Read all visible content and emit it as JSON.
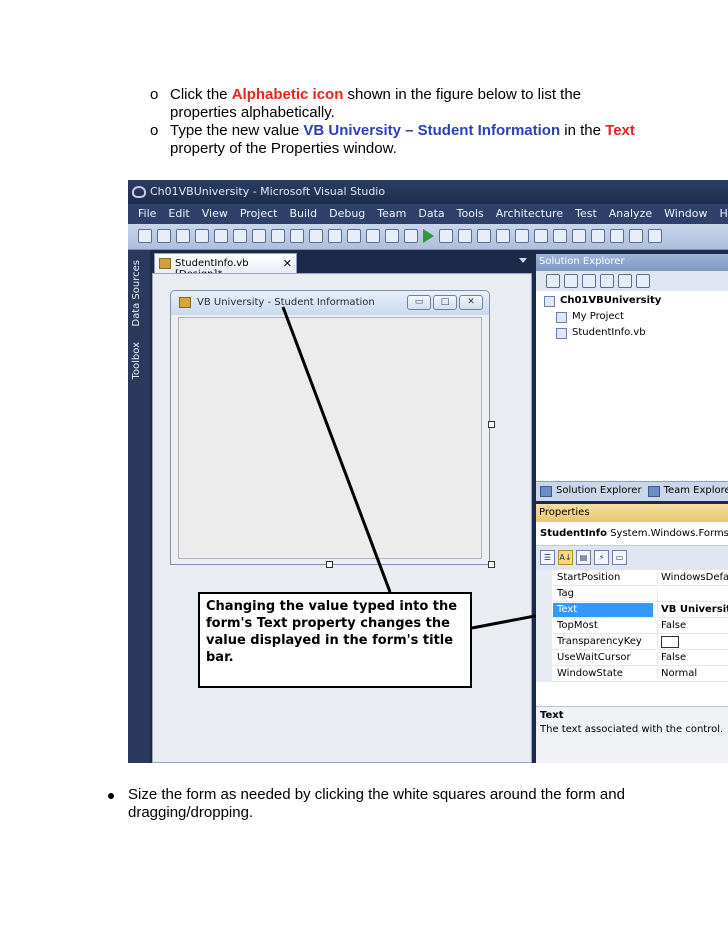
{
  "instructions": {
    "item1": {
      "marker": "o",
      "pre": "Click the ",
      "highlight": "Alphabetic icon",
      "post": " shown in the figure below to list the properties alphabetically."
    },
    "item2": {
      "marker": "o",
      "pre": "Type the new value ",
      "highlight1": "VB University – Student Information",
      "mid": " in the ",
      "highlight2": "Text",
      "post": " property of the Properties window."
    },
    "bottom_bullet": "Size the form as needed by clicking the white squares around the form and dragging/dropping."
  },
  "vs": {
    "window_title": "Ch01VBUniversity - Microsoft Visual Studio",
    "menu": [
      "File",
      "Edit",
      "View",
      "Project",
      "Build",
      "Debug",
      "Team",
      "Data",
      "Tools",
      "Architecture",
      "Test",
      "Analyze",
      "Window",
      "Help"
    ],
    "left_rail": {
      "data_sources": "Data Sources",
      "toolbox": "Toolbox"
    },
    "doc_tab": {
      "label": "StudentInfo.vb [Design]*",
      "close": "✕"
    },
    "form": {
      "title": "VB University - Student Information",
      "minimize": "▭",
      "maximize": "□",
      "close": "✕"
    },
    "callout": "Changing the value typed into the form's Text property changes the value displayed in the form's title bar.",
    "solution_explorer": {
      "header": "Solution Explorer",
      "items": [
        "Ch01VBUniversity",
        "My Project",
        "StudentInfo.vb"
      ],
      "tabs": [
        "Solution Explorer",
        "Team Explore"
      ]
    },
    "properties": {
      "header": "Properties",
      "object_name": "StudentInfo",
      "object_type": "System.Windows.Forms.F",
      "alpha_icon": "A↓",
      "rows": [
        {
          "name": "StartPosition",
          "value": "WindowsDefau"
        },
        {
          "name": "Tag",
          "value": ""
        },
        {
          "name": "Text",
          "value": "VB University"
        },
        {
          "name": "TopMost",
          "value": "False"
        },
        {
          "name": "TransparencyKey",
          "value": ""
        },
        {
          "name": "UseWaitCursor",
          "value": "False"
        },
        {
          "name": "WindowState",
          "value": "Normal"
        }
      ],
      "desc_title": "Text",
      "desc_text": "The text associated with the control."
    }
  }
}
